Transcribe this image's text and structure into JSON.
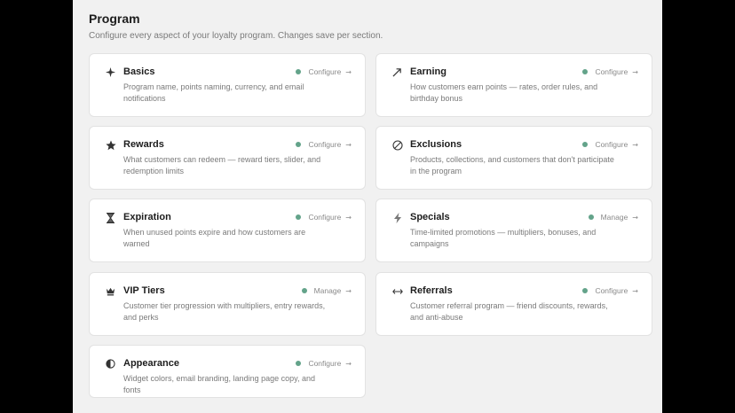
{
  "header": {
    "title": "Program",
    "subtitle": "Configure every aspect of your loyalty program. Changes save per section."
  },
  "cards": [
    {
      "title": "Basics",
      "description": "Program name, points naming, currency, and email notifications",
      "action": "Configure",
      "arrow": "→",
      "icon": "sparkle-icon",
      "status_color": "#63a38a"
    },
    {
      "title": "Earning",
      "description": "How customers earn points — rates, order rules, and birthday bonus",
      "action": "Configure",
      "arrow": "→",
      "icon": "trend-up-icon",
      "status_color": "#63a38a"
    },
    {
      "title": "Rewards",
      "description": "What customers can redeem — reward tiers, slider, and redemption limits",
      "action": "Configure",
      "arrow": "→",
      "icon": "star-icon",
      "status_color": "#63a38a"
    },
    {
      "title": "Exclusions",
      "description": "Products, collections, and customers that don't participate in the program",
      "action": "Configure",
      "arrow": "→",
      "icon": "prohibited-icon",
      "status_color": "#63a38a"
    },
    {
      "title": "Expiration",
      "description": "When unused points expire and how customers are warned",
      "action": "Configure",
      "arrow": "→",
      "icon": "hourglass-icon",
      "status_color": "#63a38a"
    },
    {
      "title": "Specials",
      "description": "Time-limited promotions — multipliers, bonuses, and campaigns",
      "action": "Manage",
      "arrow": "→",
      "icon": "lightning-icon",
      "status_color": "#63a38a"
    },
    {
      "title": "VIP Tiers",
      "description": "Customer tier progression with multipliers, entry rewards, and perks",
      "action": "Manage",
      "arrow": "→",
      "icon": "crown-icon",
      "status_color": "#63a38a"
    },
    {
      "title": "Referrals",
      "description": "Customer referral program — friend discounts, rewards, and anti-abuse",
      "action": "Configure",
      "arrow": "→",
      "icon": "arrows-horizontal-icon",
      "status_color": "#63a38a"
    },
    {
      "title": "Appearance",
      "description": "Widget colors, email branding, landing page copy, and fonts",
      "action": "Configure",
      "arrow": "→",
      "icon": "half-circle-icon",
      "status_color": "#63a38a"
    }
  ]
}
